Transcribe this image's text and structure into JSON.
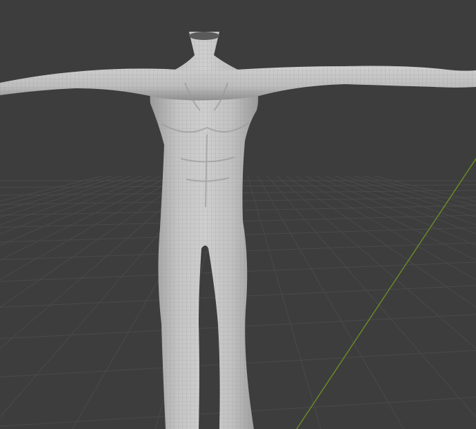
{
  "viewport": {
    "mode": "3d-viewport",
    "object": "humanoid-body-mesh",
    "shading": "solid",
    "wireframe_overlay": true,
    "pose": "t-pose"
  },
  "colors": {
    "background": "#3d3d3d",
    "grid_line": "#4a4a4a",
    "y_axis": "#6b8e23",
    "mesh_fill": "#c8c8c8",
    "mesh_shadow": "#9a9a9a",
    "wire": "#8a8a8a"
  }
}
